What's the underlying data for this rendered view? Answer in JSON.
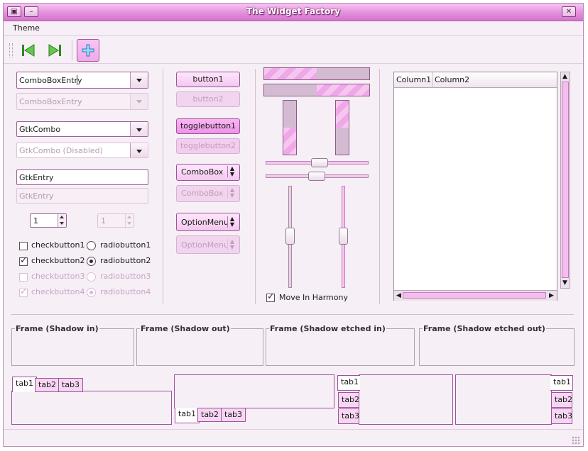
{
  "window": {
    "title": "The Widget Factory"
  },
  "menu": {
    "theme": "Theme"
  },
  "combos": {
    "entry1": "ComboBoxEntry",
    "entry2": "ComboBoxEntry",
    "gtk1": "GtkCombo",
    "gtk2": "GtkCombo (Disabled)"
  },
  "entries": {
    "e1": "GtkEntry",
    "e2": "GtkEntry"
  },
  "spins": {
    "s1": "1",
    "s2": "1"
  },
  "checks": [
    {
      "label": "checkbutton1",
      "checked": false
    },
    {
      "label": "checkbutton2",
      "checked": true
    },
    {
      "label": "checkbutton3",
      "checked": false
    },
    {
      "label": "checkbutton4",
      "checked": true
    }
  ],
  "radios": [
    {
      "label": "radiobutton1",
      "checked": false
    },
    {
      "label": "radiobutton2",
      "checked": true
    },
    {
      "label": "radiobutton3",
      "checked": false
    },
    {
      "label": "radiobutton4",
      "checked": true
    }
  ],
  "buttons": {
    "b1": "button1",
    "b2": "button2",
    "t1": "togglebutton1",
    "t2": "togglebutton2",
    "c1": "ComboBox",
    "c2": "ComboBox",
    "o1": "OptionMenu",
    "o2": "OptionMenu"
  },
  "sliders": {
    "harmony_label": "Move In Harmony",
    "harmony_checked": true
  },
  "progress": {
    "h1": 0.5,
    "h2": 0.5,
    "v1": 0.5,
    "v2": 0.5
  },
  "tree": {
    "col1": "Column1",
    "col2": "Column2"
  },
  "frames": [
    "Frame (Shadow in)",
    "Frame (Shadow out)",
    "Frame (Shadow etched in)",
    "Frame (Shadow etched out)"
  ],
  "tabs": {
    "t1": "tab1",
    "t2": "tab2",
    "t3": "tab3"
  },
  "colors": {
    "accent": "#e58fdd",
    "background": "#f6eff6"
  }
}
